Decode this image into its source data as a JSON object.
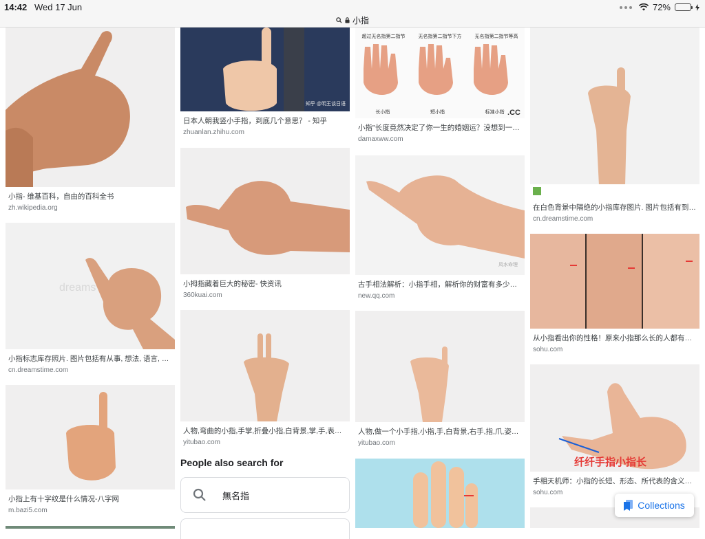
{
  "status": {
    "time": "14:42",
    "date": "Wed 17 Jun",
    "battery": "72%",
    "battery_level": 0.72
  },
  "url": {
    "text": "小指"
  },
  "results": {
    "c1": [
      {
        "title": "小指- 维基百科，自由的百科全书",
        "source": "zh.wikipedia.org"
      },
      {
        "title": "小指标志库存照片. 图片包括有从事, 想法, 语言, 饶...",
        "source": "cn.dreamstime.com"
      },
      {
        "title": "小指上有十字纹是什么情况-八字网",
        "source": "m.bazi5.com"
      }
    ],
    "c2": [
      {
        "title": "日本人朝我竖小手指，到底几个意思？ - 知乎",
        "source": "zhuanlan.zhihu.com"
      },
      {
        "title": "小拇指藏着巨大的秘密- 快资讯",
        "source": "360kuai.com"
      },
      {
        "title": "人物,弯曲的小指,手掌,折叠小指,白背景,掌,手,表情,...",
        "source": "yitubao.com"
      }
    ],
    "c3": [
      {
        "title": "小指\"长度竟然决定了你一生的婚姻运？没想到一只...",
        "source": "damaxww.com"
      },
      {
        "title": "古手相法解析：小指手相，解析你的财富有多少！-...",
        "source": "new.qq.com"
      },
      {
        "title": "人物,做一个小手指,小指,手,白背景,右手,指,爪,姿势...",
        "source": "yitubao.com"
      }
    ],
    "c4": [
      {
        "title": "在白色背景中隔绝的小指库存图片. 图片包括有到达...",
        "source": "cn.dreamstime.com"
      },
      {
        "title": "从小指看出你的性格！原来小指那么长的人都有领...",
        "source": "sohu.com"
      },
      {
        "title": "手相天机师：小指的长短、形态、所代表的含义！_...",
        "source": "sohu.com"
      }
    ]
  },
  "image_text": {
    "zhihu_watermark": "知乎 @明王谈日语",
    "palm_caption_1": "超过无名指第二指节",
    "palm_caption_2": "无名指第二指节下方",
    "palm_caption_3": "无名指第二指节等高",
    "palm_label_1": "长小指",
    "palm_label_2": "短小指",
    "palm_label_3": "标准小指",
    "dm_mark": ".CC",
    "sohu_caption": "纤纤手指小指长",
    "qq_watermark": "风水命理",
    "dreams_watermark": "dreams"
  },
  "people_also": {
    "heading": "People also search for",
    "items": [
      {
        "label": "無名指"
      }
    ]
  },
  "collections": {
    "label": "Collections"
  },
  "colors": {
    "accent": "#1a73e8",
    "battery": "#4cd964",
    "watermark_red": "#e53935"
  }
}
